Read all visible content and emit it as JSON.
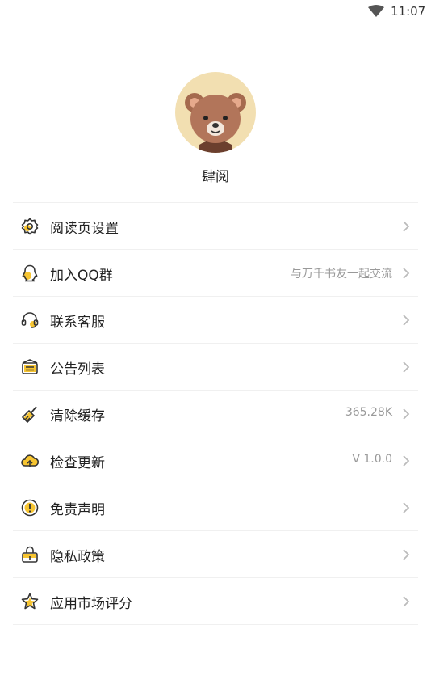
{
  "status_bar": {
    "time": "11:07",
    "wifi_icon": "wifi-icon"
  },
  "profile": {
    "avatar_icon": "bear-avatar",
    "name": "肆阅"
  },
  "menu": [
    {
      "label": "阅读页设置",
      "value": "",
      "icon": "gear-icon"
    },
    {
      "label": "加入QQ群",
      "value": "与万千书友一起交流",
      "icon": "qq-penguin-icon"
    },
    {
      "label": "联系客服",
      "value": "",
      "icon": "headset-icon"
    },
    {
      "label": "公告列表",
      "value": "",
      "icon": "notice-box-icon"
    },
    {
      "label": "清除缓存",
      "value": "365.28K",
      "icon": "broom-icon"
    },
    {
      "label": "检查更新",
      "value": "V 1.0.0",
      "icon": "cloud-upload-icon"
    },
    {
      "label": "免责声明",
      "value": "",
      "icon": "exclamation-circle-icon"
    },
    {
      "label": "隐私政策",
      "value": "",
      "icon": "lock-icon"
    },
    {
      "label": "应用市场评分",
      "value": "",
      "icon": "star-icon"
    }
  ],
  "colors": {
    "accent": "#f7c531",
    "stroke": "#333333",
    "divider": "#f0f0f0",
    "secondary_text": "#999999",
    "avatar_bg": "#f2dfb1"
  }
}
